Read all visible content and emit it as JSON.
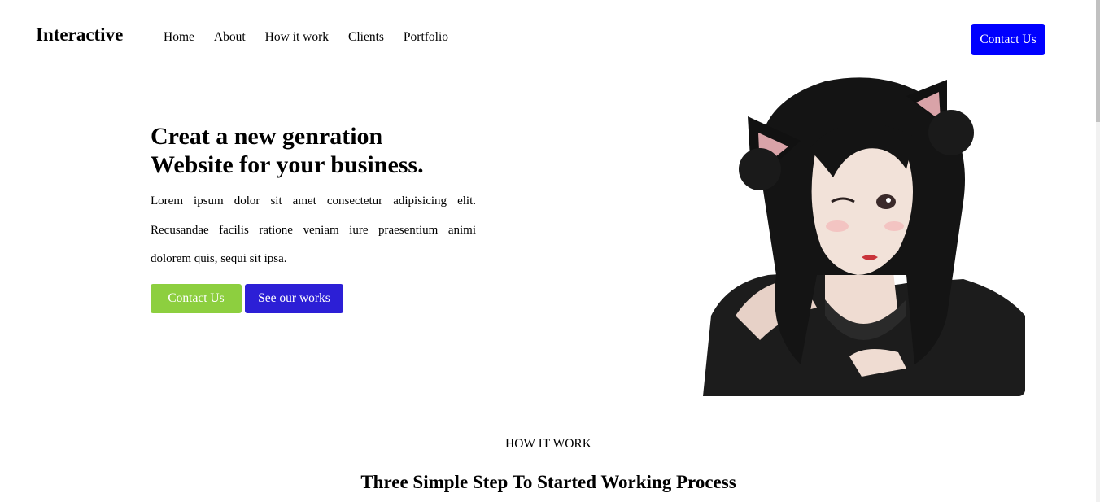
{
  "header": {
    "logo": "Interactive",
    "nav": [
      "Home",
      "About",
      "How it work",
      "Clients",
      "Portfolio"
    ],
    "cta_label": "Contact Us",
    "cta_color": "#0000ff"
  },
  "hero": {
    "title_line1": "Creat a new genration",
    "title_line2": "Website for your business.",
    "text": "Lorem ipsum dolor sit amet consectetur adipisicing elit. Recusandae facilis ratione veniam iure praesentium animi dolorem quis, sequi sit ipsa.",
    "primary_button": "Contact Us",
    "secondary_button": "See our works",
    "primary_color": "#8dcf3f",
    "secondary_color": "#2c1fd6",
    "image_icon": "anime-girl-cat-ears-illustration"
  },
  "how_it_work": {
    "label": "HOW IT WORK",
    "title": "Three Simple Step To Started Working Process"
  }
}
